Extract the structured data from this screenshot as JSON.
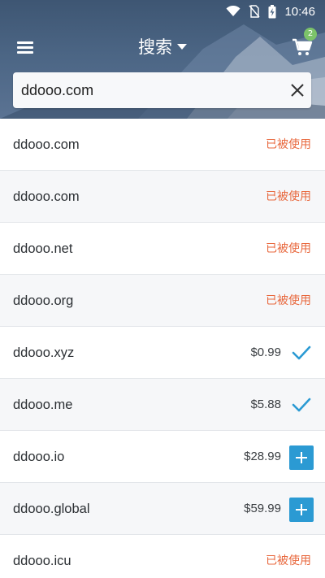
{
  "status_bar": {
    "time": "10:46"
  },
  "header": {
    "title": "搜索",
    "cart_count": "2"
  },
  "search": {
    "value": "ddooo.com"
  },
  "results": [
    {
      "domain": "ddooo.com",
      "status": "taken",
      "status_label": "已被使用"
    },
    {
      "domain": "ddooo.com",
      "status": "taken",
      "status_label": "已被使用"
    },
    {
      "domain": "ddooo.net",
      "status": "taken",
      "status_label": "已被使用"
    },
    {
      "domain": "ddooo.org",
      "status": "taken",
      "status_label": "已被使用"
    },
    {
      "domain": "ddooo.xyz",
      "status": "in_cart",
      "price": "$0.99"
    },
    {
      "domain": "ddooo.me",
      "status": "in_cart",
      "price": "$5.88"
    },
    {
      "domain": "ddooo.io",
      "status": "available",
      "price": "$28.99"
    },
    {
      "domain": "ddooo.global",
      "status": "available",
      "price": "$59.99"
    },
    {
      "domain": "ddooo.icu",
      "status": "taken",
      "status_label": "已被使用"
    }
  ],
  "colors": {
    "taken": "#e8673c",
    "accent": "#2b9ad3",
    "badge": "#7cc36a"
  }
}
